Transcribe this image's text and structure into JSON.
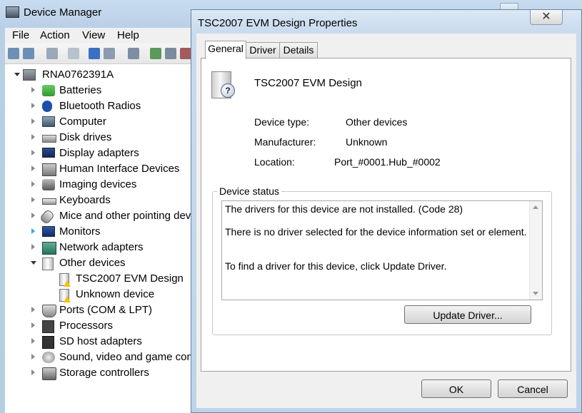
{
  "device_manager": {
    "title": "Device Manager",
    "menu": [
      "File",
      "Action",
      "View",
      "Help"
    ],
    "tree": {
      "root": "RNA0762391A",
      "items": [
        {
          "label": "Batteries"
        },
        {
          "label": "Bluetooth Radios"
        },
        {
          "label": "Computer"
        },
        {
          "label": "Disk drives"
        },
        {
          "label": "Display adapters"
        },
        {
          "label": "Human Interface Devices"
        },
        {
          "label": "Imaging devices"
        },
        {
          "label": "Keyboards"
        },
        {
          "label": "Mice and other pointing dev"
        },
        {
          "label": "Monitors"
        },
        {
          "label": "Network adapters"
        },
        {
          "label": "Other devices",
          "expanded": true,
          "children": [
            "TSC2007 EVM Design",
            "Unknown device"
          ]
        },
        {
          "label": "Ports (COM & LPT)"
        },
        {
          "label": "Processors"
        },
        {
          "label": "SD host adapters"
        },
        {
          "label": "Sound, video and game con"
        },
        {
          "label": "Storage controllers"
        }
      ]
    }
  },
  "dialog": {
    "title": "TSC2007 EVM Design Properties",
    "close_glyph": "✕",
    "tabs": [
      "General",
      "Driver",
      "Details"
    ],
    "active_tab": "General",
    "device_name": "TSC2007 EVM Design",
    "properties": {
      "device_type_label": "Device type:",
      "device_type_value": "Other devices",
      "manufacturer_label": "Manufacturer:",
      "manufacturer_value": "Unknown",
      "location_label": "Location:",
      "location_value": "Port_#0001.Hub_#0002"
    },
    "device_status": {
      "legend": "Device status",
      "lines": [
        "The drivers for this device are not installed. (Code 28)",
        "There is no driver selected for the device information set or element.",
        "To find a driver for this device, click Update Driver."
      ]
    },
    "update_driver_button": "Update Driver...",
    "ok_button": "OK",
    "cancel_button": "Cancel"
  },
  "colors": {
    "warning": "#f2c40c",
    "expander_highlight": "#2aa9e0"
  }
}
